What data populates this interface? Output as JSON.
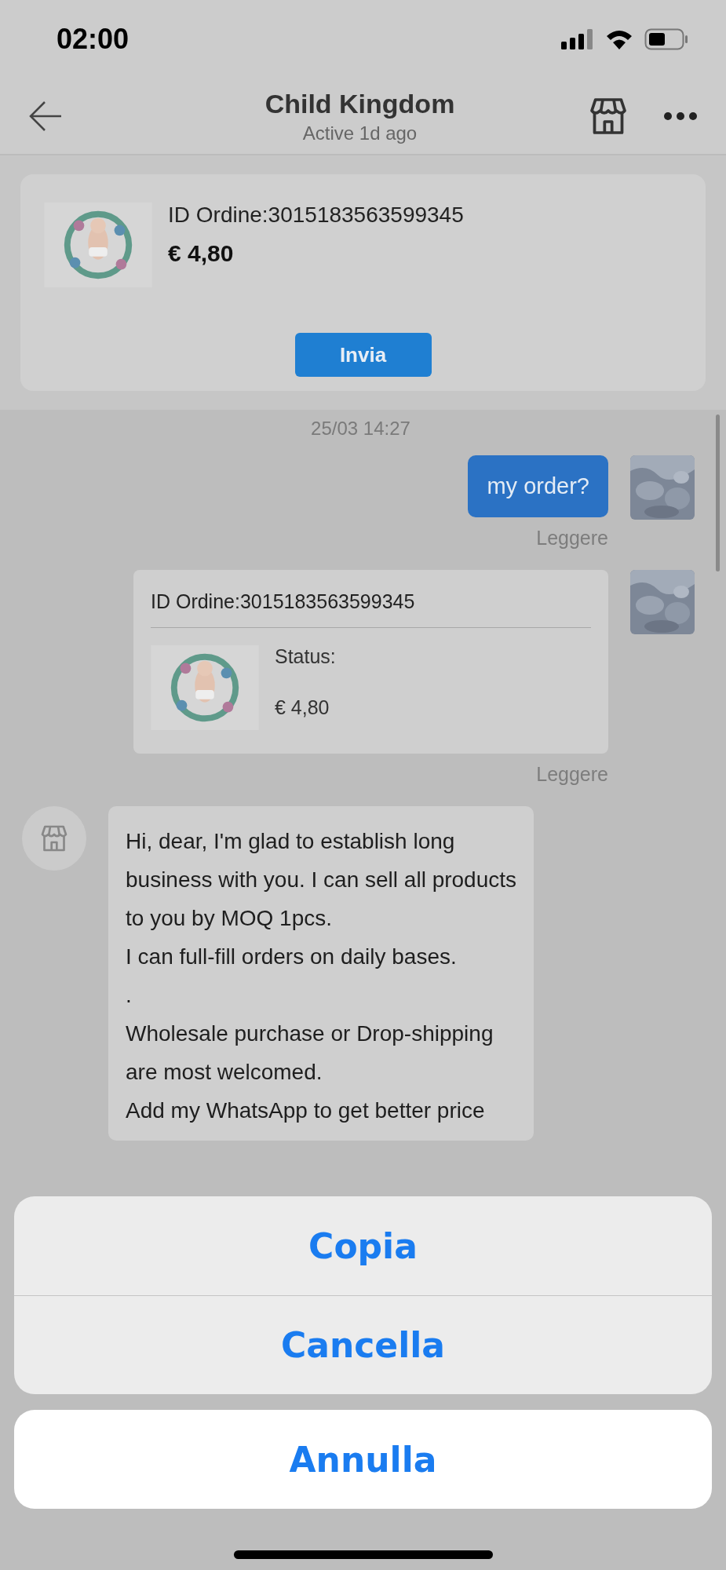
{
  "status_bar": {
    "time": "02:00"
  },
  "header": {
    "title": "Child Kingdom",
    "subtitle": "Active 1d ago"
  },
  "order_card": {
    "order_id": "ID Ordine:3015183563599345",
    "price": "€ 4,80",
    "button": "Invia"
  },
  "messages": [
    {
      "kind": "timestamp",
      "text": "25/03 14:27"
    },
    {
      "kind": "text",
      "outgoing": true,
      "text": "my order?",
      "status": "Leggere"
    },
    {
      "kind": "order",
      "outgoing": true,
      "order_id": "ID Ordine:3015183563599345",
      "status_label": "Status:",
      "price": "€ 4,80",
      "status": "Leggere"
    },
    {
      "kind": "text",
      "outgoing": false,
      "text": "Hi, dear, I'm glad to establish long\nbusiness with you. I can sell all products\nto you by MOQ 1pcs.\nI can full-fill orders on daily bases.\n.\nWholesale purchase or Drop-shipping\nare most welcomed.\nAdd my WhatsApp to get better price"
    }
  ],
  "action_sheet": {
    "actions": [
      "Copia",
      "Cancella"
    ],
    "cancel": "Annulla"
  }
}
